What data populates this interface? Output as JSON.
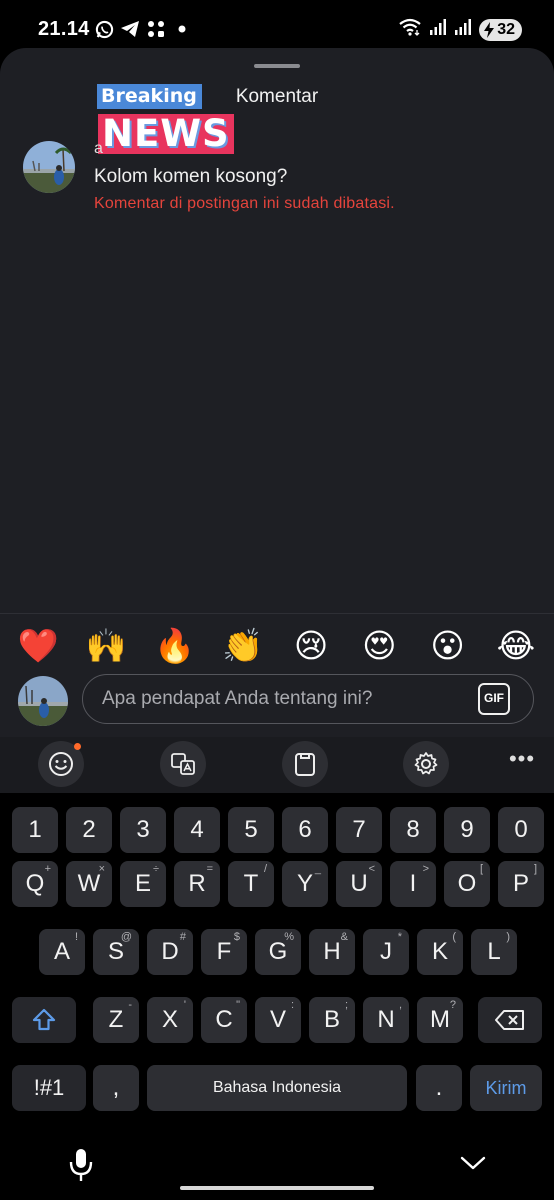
{
  "status": {
    "time": "21.14",
    "battery": "32",
    "icons_left": [
      "whatsapp-icon",
      "telegram-icon",
      "apps-icon",
      "dot-icon"
    ],
    "icons_right": [
      "wifi-icon",
      "signal-icon",
      "signal-icon-2",
      "battery-charging-icon"
    ]
  },
  "sheet": {
    "title": "Komentar",
    "logo": {
      "line1": "Breaking",
      "line2": "NEWS"
    },
    "comment": {
      "author_initial": "a",
      "text": "Kolom komen kosong?",
      "notice": "Komentar di postingan ini sudah dibatasi."
    }
  },
  "emojis": [
    "❤️",
    "🙌",
    "🔥",
    "👏",
    "😢",
    "😍",
    "😮",
    "😂"
  ],
  "input": {
    "placeholder": "Apa pendapat Anda tentang ini?",
    "gif_label": "GIF"
  },
  "keyboard": {
    "numbers": [
      "1",
      "2",
      "3",
      "4",
      "5",
      "6",
      "7",
      "8",
      "9",
      "0"
    ],
    "row1": [
      {
        "k": "Q",
        "h": "+"
      },
      {
        "k": "W",
        "h": "×"
      },
      {
        "k": "E",
        "h": "÷"
      },
      {
        "k": "R",
        "h": "="
      },
      {
        "k": "T",
        "h": "/"
      },
      {
        "k": "Y",
        "h": "_"
      },
      {
        "k": "U",
        "h": "<"
      },
      {
        "k": "I",
        "h": ">"
      },
      {
        "k": "O",
        "h": "["
      },
      {
        "k": "P",
        "h": "]"
      }
    ],
    "row2": [
      {
        "k": "A",
        "h": "!"
      },
      {
        "k": "S",
        "h": "@"
      },
      {
        "k": "D",
        "h": "#"
      },
      {
        "k": "F",
        "h": "$"
      },
      {
        "k": "G",
        "h": "%"
      },
      {
        "k": "H",
        "h": "&"
      },
      {
        "k": "J",
        "h": "*"
      },
      {
        "k": "K",
        "h": "("
      },
      {
        "k": "L",
        "h": ")"
      }
    ],
    "row3": [
      {
        "k": "Z",
        "h": "-"
      },
      {
        "k": "X",
        "h": "'"
      },
      {
        "k": "C",
        "h": "\""
      },
      {
        "k": "V",
        "h": ":"
      },
      {
        "k": "B",
        "h": ";"
      },
      {
        "k": "N",
        "h": ","
      },
      {
        "k": "M",
        "h": "?"
      }
    ],
    "symbols_label": "!#1",
    "comma": ",",
    "space_label": "Bahasa Indonesia",
    "period": ".",
    "send_label": "Kirim"
  }
}
